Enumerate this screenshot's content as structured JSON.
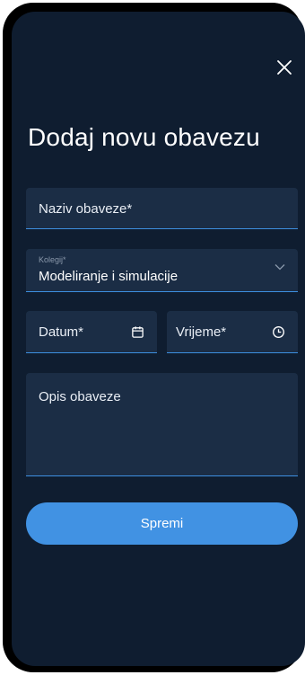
{
  "form": {
    "title": "Dodaj novu obavezu",
    "name_placeholder": "Naziv obaveze*",
    "course": {
      "label": "Kolegij*",
      "value": "Modeliranje i simulacije"
    },
    "date_placeholder": "Datum*",
    "time_placeholder": "Vrijeme*",
    "description_placeholder": "Opis obaveze",
    "save_label": "Spremi"
  },
  "icons": {
    "close": "close-icon",
    "dropdown": "chevron-down-icon",
    "date": "calendar-icon",
    "time": "clock-icon"
  },
  "colors": {
    "background": "#0f1d30",
    "field": "#1b2d45",
    "accent": "#4192e3"
  }
}
